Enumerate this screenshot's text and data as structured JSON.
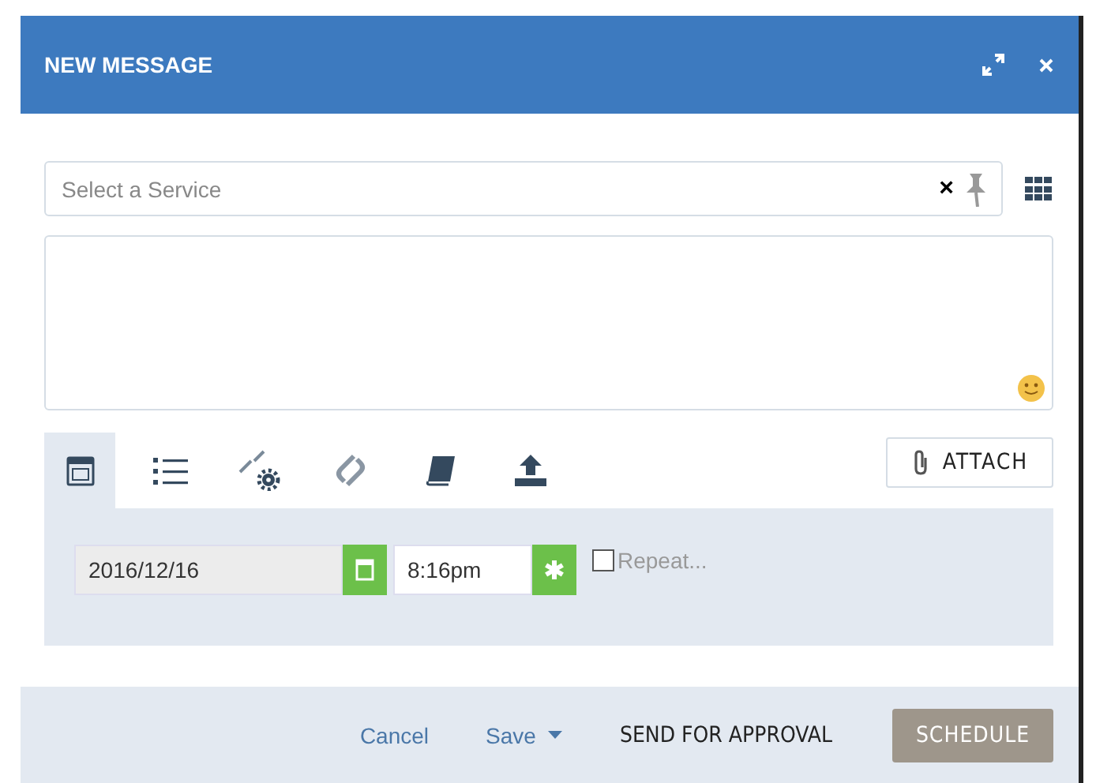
{
  "window": {
    "title": "NEW MESSAGE"
  },
  "service": {
    "placeholder": "Select a Service",
    "clear": "×"
  },
  "tabs": [
    {
      "kind": "calendar",
      "selected": true
    },
    {
      "kind": "list",
      "selected": false
    },
    {
      "kind": "compress",
      "selected": false
    },
    {
      "kind": "link",
      "selected": false
    },
    {
      "kind": "book",
      "selected": false
    },
    {
      "kind": "upload",
      "selected": false
    }
  ],
  "attach": "ATTACH",
  "schedule": {
    "date": "2016/12/16",
    "time": "8:16pm",
    "repeat": {
      "label": "Repeat...",
      "checked": false
    }
  },
  "footer": {
    "cancel": "Cancel",
    "save": "Save",
    "send": "SEND FOR APPROVAL",
    "schedule": "SCHEDULE"
  }
}
